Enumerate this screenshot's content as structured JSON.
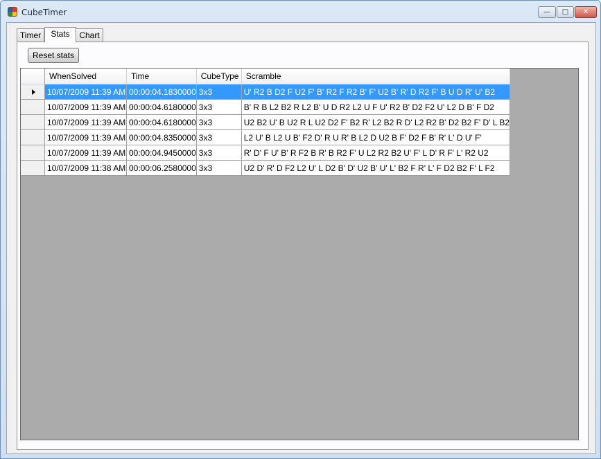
{
  "window": {
    "title": "CubeTimer",
    "minimize_glyph": "—",
    "maximize_glyph": "□",
    "close_glyph": "✕"
  },
  "tabs": [
    {
      "label": "Timer",
      "active": false
    },
    {
      "label": "Stats",
      "active": true
    },
    {
      "label": "Chart",
      "active": false
    }
  ],
  "toolbar": {
    "reset_label": "Reset stats"
  },
  "grid": {
    "columns": [
      "WhenSolved",
      "Time",
      "CubeType",
      "Scramble"
    ],
    "rows": [
      [
        "10/07/2009 11:39 AM",
        "00:00:04.1830000",
        "3x3",
        "U' R2 B D2 F U2 F' B' R2 F R2 B' F' U2 B' R' D R2 F' B U D R' U' B2"
      ],
      [
        "10/07/2009 11:39 AM",
        "00:00:04.6180000",
        "3x3",
        "B' R B L2 B2 R L2 B' U D R2 L2 U F U' R2 B' D2 F2 U' L2 D B' F D2"
      ],
      [
        "10/07/2009 11:39 AM",
        "00:00:04.6180000",
        "3x3",
        "U2 B2 U' B U2 R L U2 D2 F' B2 R' L2 B2 R D' L2 R2 B' D2 B2 F' D' L B2"
      ],
      [
        "10/07/2009 11:39 AM",
        "00:00:04.8350000",
        "3x3",
        "L2 U' B L2 U B' F2 D' R U R' B L2 D U2 B F' D2 F B' R' L' D U' F'"
      ],
      [
        "10/07/2009 11:39 AM",
        "00:00:04.9450000",
        "3x3",
        "R' D' F U' B' R F2 B R' B R2 F' U L2 R2 B2 U' F' L D' R F' L' R2 U2"
      ],
      [
        "10/07/2009 11:38 AM",
        "00:00:06.2580000",
        "3x3",
        "U2 D' R' D F2 L2 U' L D2 B' D' U2 B' U' L' B2 F R' L' F D2 B2 F' L F2"
      ]
    ],
    "selected_row": 0
  },
  "colors": {
    "selection": "#3399ff",
    "grid_background": "#ababab"
  },
  "icons": {
    "app": "cube-icon",
    "row_indicator": "triangle-right-icon"
  }
}
